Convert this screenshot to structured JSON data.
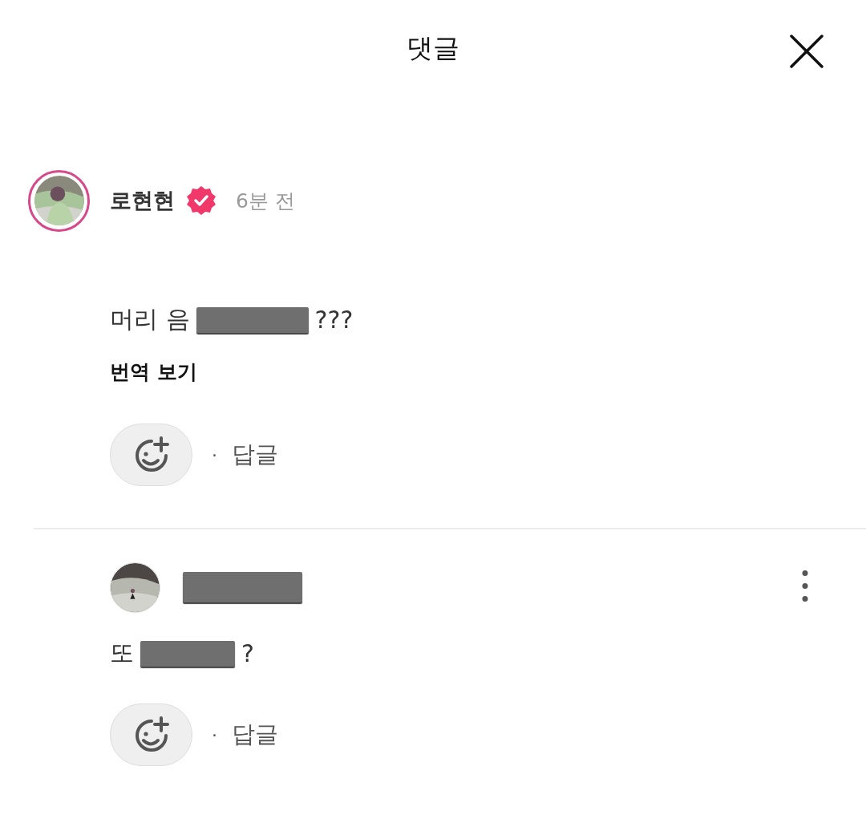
{
  "header": {
    "title": "댓글"
  },
  "comments": [
    {
      "author": [
        {
          "kind": "text",
          "text": "로현현"
        }
      ],
      "avatar_ring": true,
      "verified": true,
      "time": "6분 전",
      "more_menu": false,
      "message": [
        {
          "kind": "text",
          "text": "머리 음"
        },
        {
          "kind": "redacted"
        },
        {
          "kind": "text",
          "text": "???"
        }
      ],
      "translate": "번역 보기",
      "separator": "·",
      "reply": "답글"
    },
    {
      "author": [
        {
          "kind": "redacted"
        }
      ],
      "avatar_ring": false,
      "verified": false,
      "more_menu": true,
      "message": [
        {
          "kind": "text",
          "text": "또"
        },
        {
          "kind": "redacted"
        },
        {
          "kind": "text",
          "text": "?"
        }
      ],
      "separator": "·",
      "reply": "답글"
    }
  ]
}
